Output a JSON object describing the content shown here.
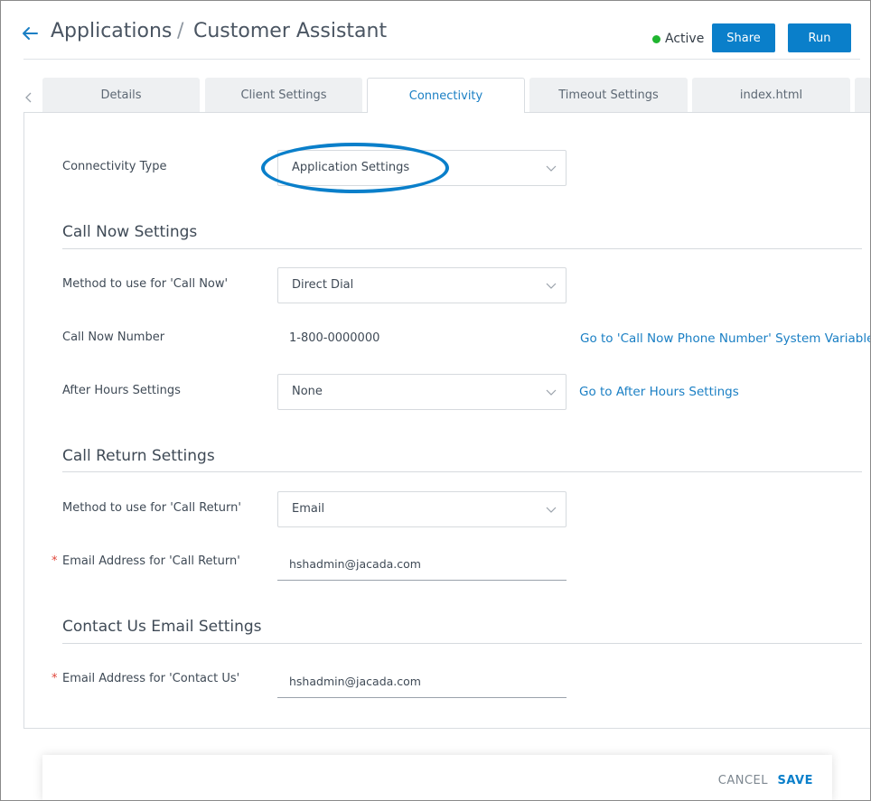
{
  "header": {
    "breadcrumb_root": "Applications",
    "breadcrumb_separator": "/",
    "breadcrumb_current": "Customer Assistant",
    "status_label": "Active",
    "status_color": "#1fb52f",
    "share_label": "Share",
    "run_label": "Run",
    "accent_color": "#0a7fca"
  },
  "tabs": [
    {
      "label": "Details",
      "active": false
    },
    {
      "label": "Client Settings",
      "active": false
    },
    {
      "label": "Connectivity",
      "active": true
    },
    {
      "label": "Timeout Settings",
      "active": false
    },
    {
      "label": "index.html",
      "active": false
    }
  ],
  "connectivity": {
    "type_label": "Connectivity Type",
    "type_value": "Application Settings"
  },
  "call_now": {
    "section_title": "Call Now Settings",
    "method_label": "Method to use for 'Call Now'",
    "method_value": "Direct Dial",
    "number_label": "Call Now Number",
    "number_value": "1-800-0000000",
    "number_link": "Go to 'Call Now Phone Number' System Variable",
    "after_hours_label": "After Hours Settings",
    "after_hours_value": "None",
    "after_hours_link": "Go to After Hours Settings"
  },
  "call_return": {
    "section_title": "Call Return Settings",
    "method_label": "Method to use for 'Call Return'",
    "method_value": "Email",
    "email_label": "Email Address for 'Call Return'",
    "email_value": "hshadmin@jacada.com"
  },
  "contact_us": {
    "section_title": "Contact Us Email Settings",
    "email_label": "Email Address for 'Contact Us'",
    "email_value": "hshadmin@jacada.com"
  },
  "required_marker": "*",
  "footer": {
    "cancel_label": "CANCEL",
    "save_label": "SAVE"
  }
}
